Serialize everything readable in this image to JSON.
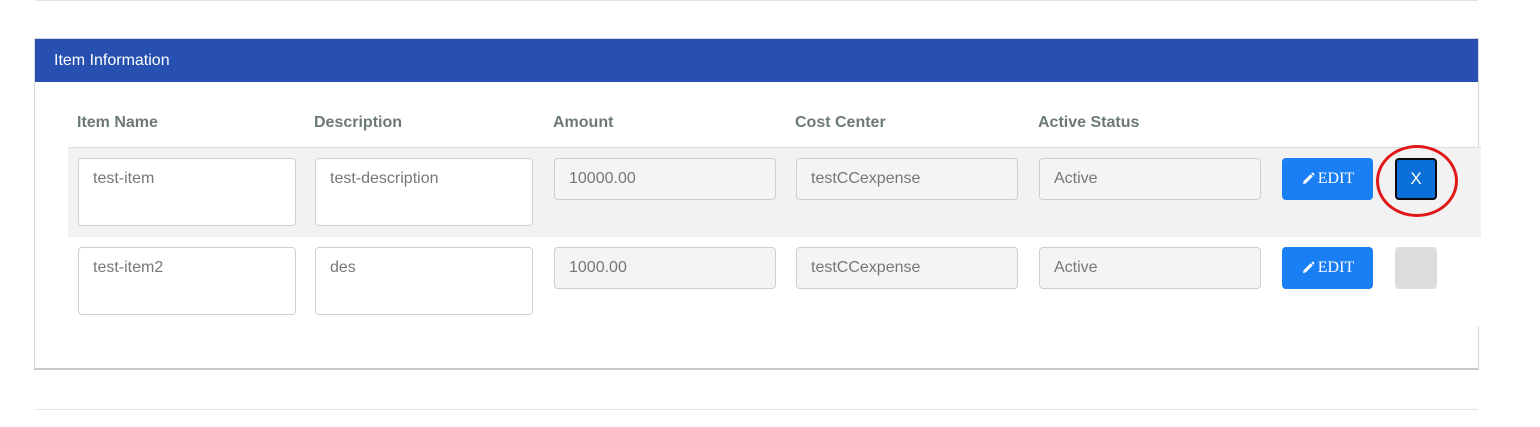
{
  "panel": {
    "title": "Item Information"
  },
  "columns": {
    "item_name": "Item Name",
    "description": "Description",
    "amount": "Amount",
    "cost_center": "Cost Center",
    "active_status": "Active Status"
  },
  "rows": [
    {
      "item_name": "test-item",
      "description": "test-description",
      "amount": "10000.00",
      "cost_center": "testCCexpense",
      "active_status": "Active",
      "edit_label": "EDIT",
      "remove_label": "X"
    },
    {
      "item_name": "test-item2",
      "description": "des",
      "amount": "1000.00",
      "cost_center": "testCCexpense",
      "active_status": "Active",
      "edit_label": "EDIT",
      "remove_label": ""
    }
  ],
  "colors": {
    "header": "#2750b0",
    "edit_button": "#1a7ef5",
    "remove_button": "#0a6fd8",
    "highlight": "#e01818"
  }
}
